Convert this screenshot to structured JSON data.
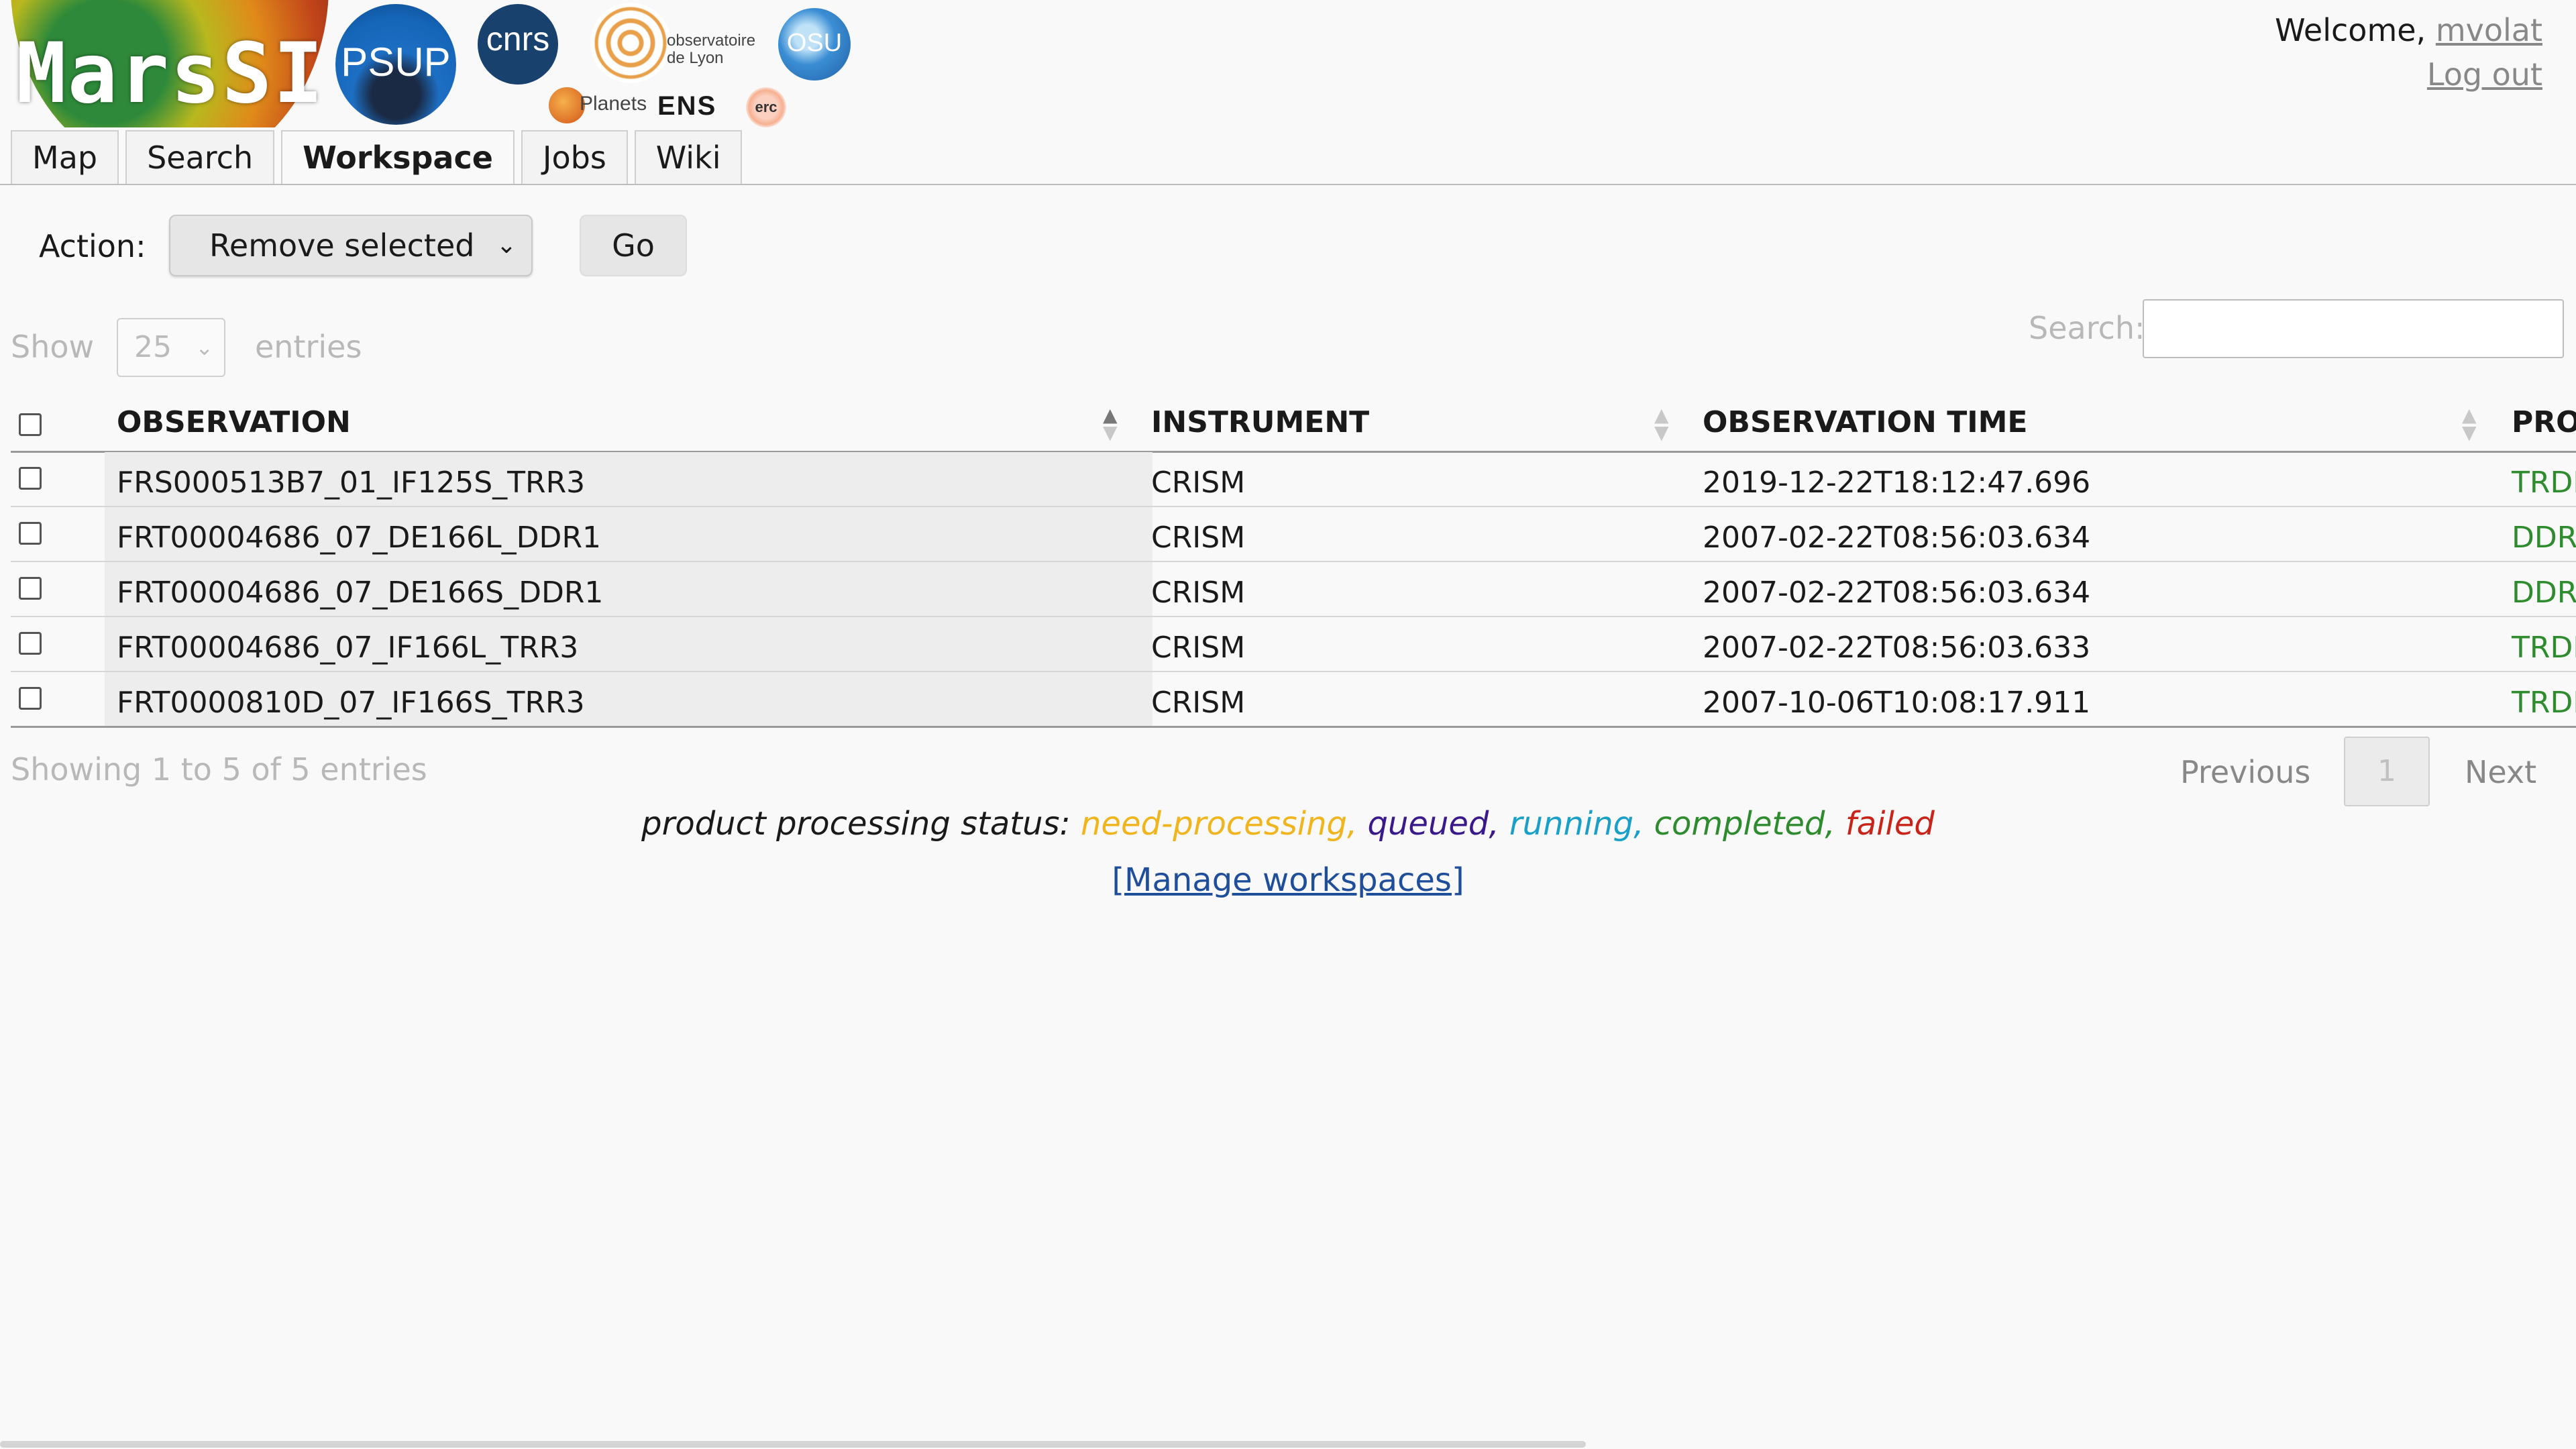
{
  "header": {
    "logos": {
      "marssi": "MarsSI",
      "psup": "PSUP",
      "cnrs": "cnrs",
      "observatoire_line1": "observatoire",
      "observatoire_line2": "de Lyon",
      "osu": "OSU",
      "planets": "Planets",
      "ens": "ENS",
      "erc": "erc"
    },
    "welcome_prefix": "Welcome,",
    "username": "mvolat",
    "logout": "Log out"
  },
  "tabs": [
    "Map",
    "Search",
    "Workspace",
    "Jobs",
    "Wiki"
  ],
  "active_tab": "Workspace",
  "action": {
    "label": "Action:",
    "selected": "Remove selected",
    "go": "Go"
  },
  "table_controls": {
    "show": "Show",
    "length": "25",
    "entries": "entries",
    "search_label": "Search:"
  },
  "table": {
    "headers": [
      "OBSERVATION",
      "INSTRUMENT",
      "OBSERVATION TIME",
      "PROD"
    ],
    "rows": [
      {
        "observation": "FRS000513B7_01_IF125S_TRR3",
        "instrument": "CRISM",
        "time": "2019-12-22T18:12:47.696",
        "product": "TRDR"
      },
      {
        "observation": "FRT00004686_07_DE166L_DDR1",
        "instrument": "CRISM",
        "time": "2007-02-22T08:56:03.634",
        "product": "DDR"
      },
      {
        "observation": "FRT00004686_07_DE166S_DDR1",
        "instrument": "CRISM",
        "time": "2007-02-22T08:56:03.634",
        "product": "DDR"
      },
      {
        "observation": "FRT00004686_07_IF166L_TRR3",
        "instrument": "CRISM",
        "time": "2007-02-22T08:56:03.633",
        "product": "TRDR"
      },
      {
        "observation": "FRT0000810D_07_IF166S_TRR3",
        "instrument": "CRISM",
        "time": "2007-10-06T10:08:17.911",
        "product": "TRDR"
      }
    ]
  },
  "pagination": {
    "info": "Showing 1 to 5 of 5 entries",
    "previous": "Previous",
    "page": "1",
    "next": "Next"
  },
  "status_legend": {
    "prefix": "product processing status:",
    "need_processing": "need-processing,",
    "queued": "queued,",
    "running": "running,",
    "completed": "completed,",
    "failed": "failed",
    "colors": {
      "need_processing": "#f0b41c",
      "queued": "#3a1a8a",
      "running": "#1aa0c8",
      "completed": "#2e8b2e",
      "failed": "#c8241a"
    }
  },
  "manage_workspaces": "[Manage workspaces]"
}
